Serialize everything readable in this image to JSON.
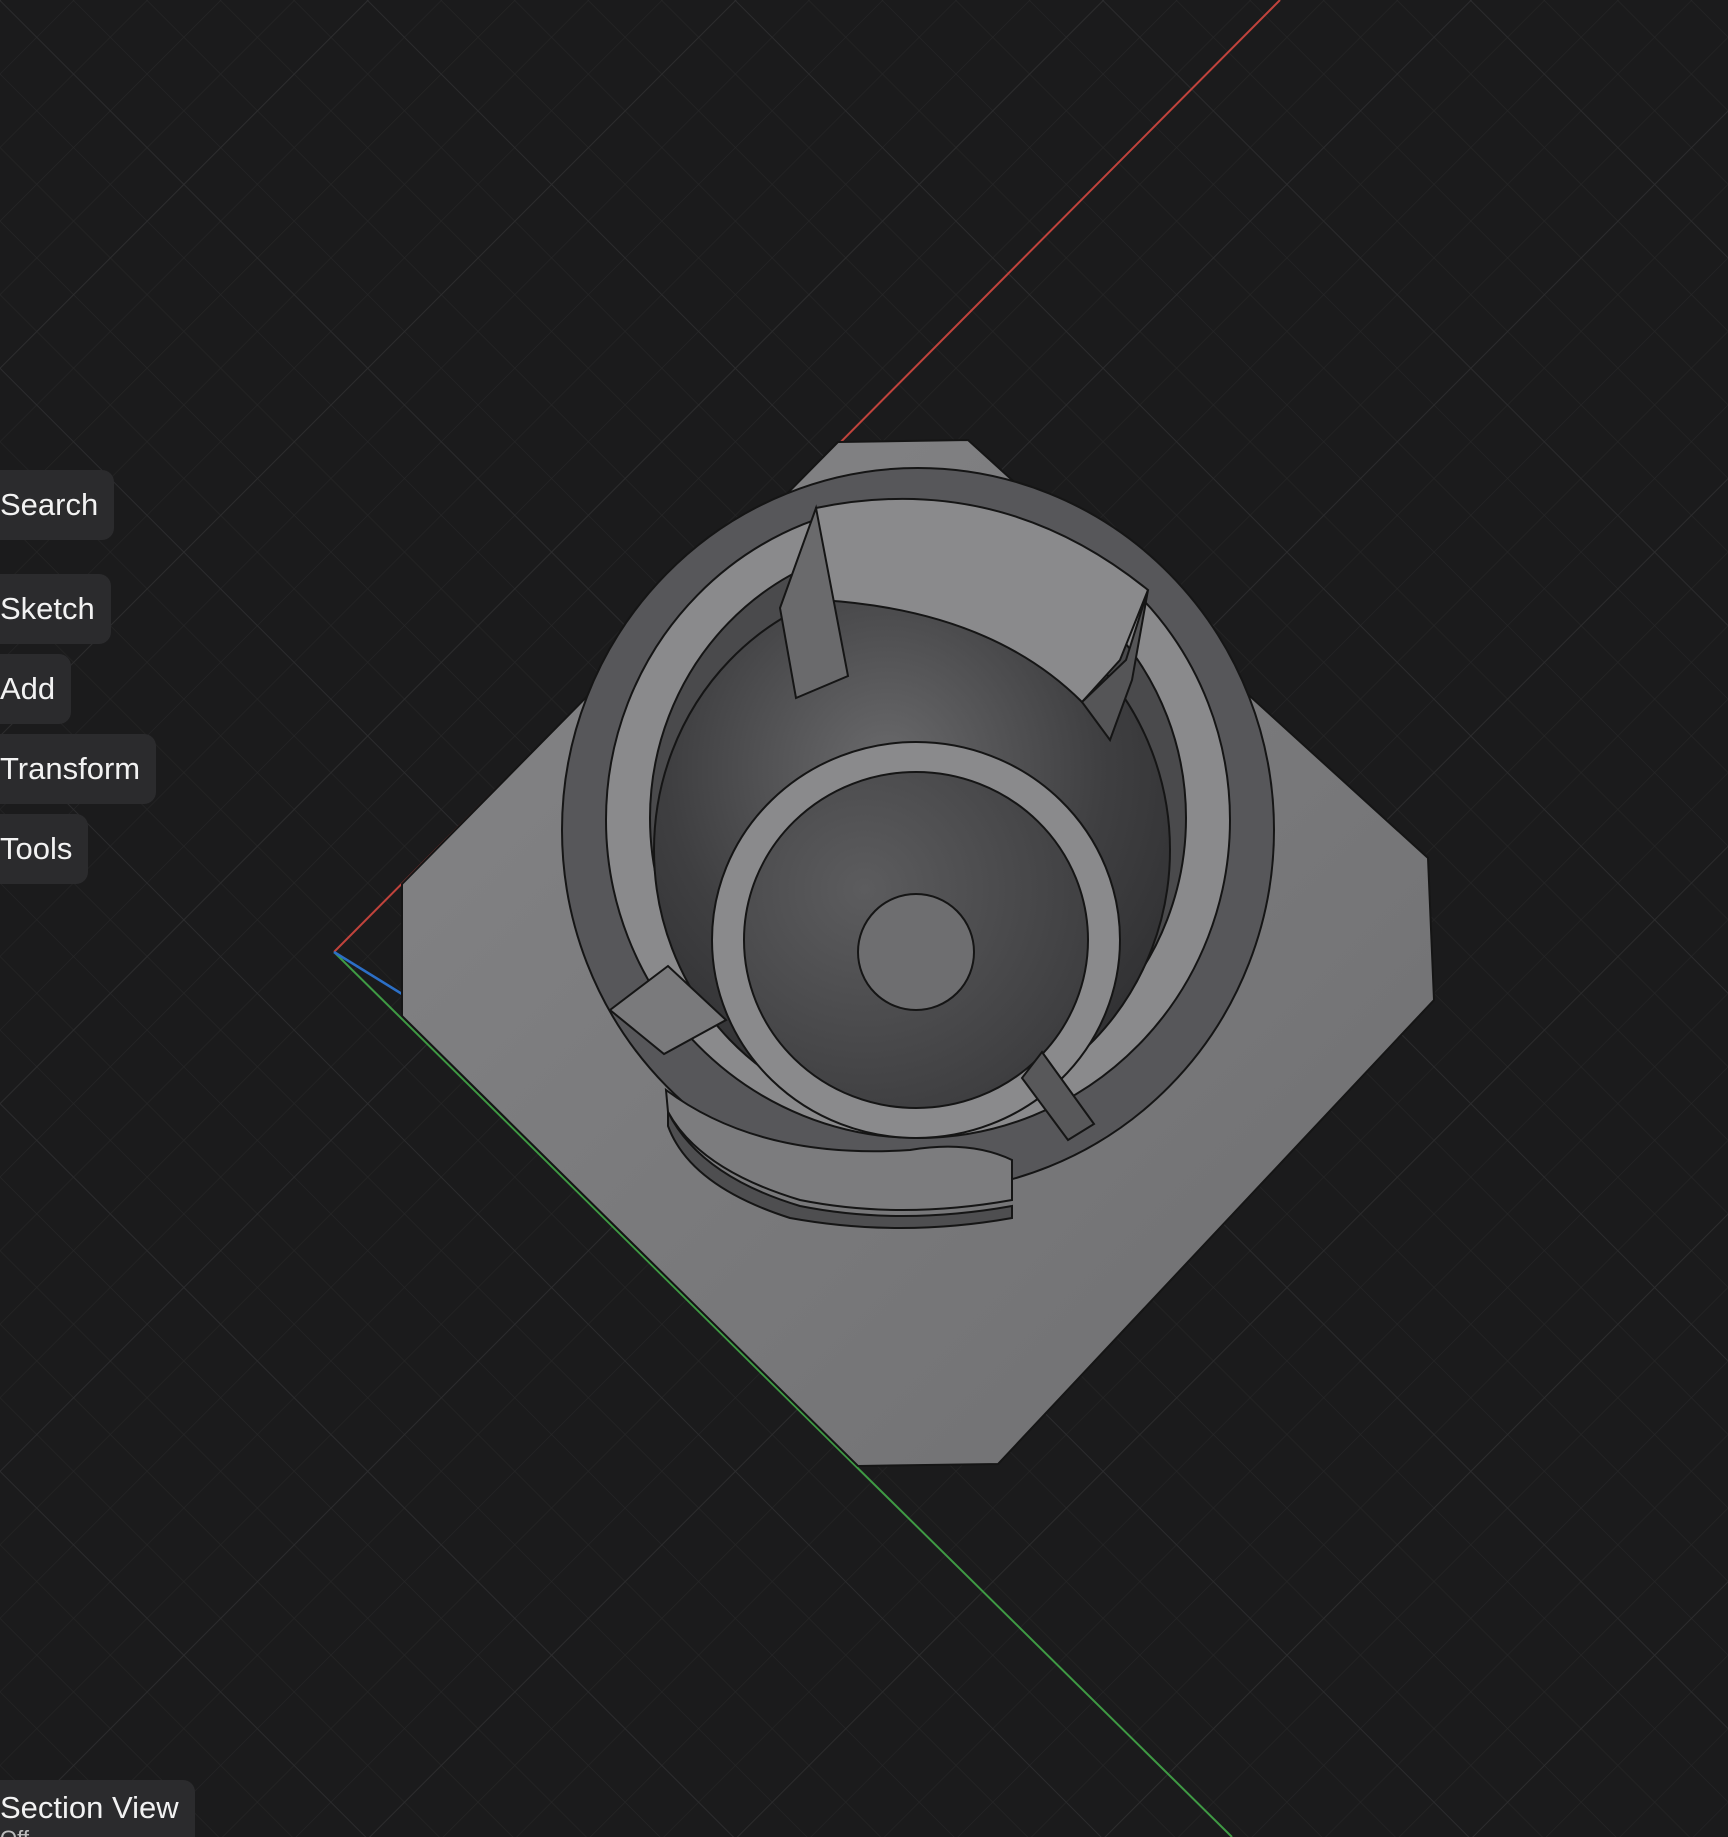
{
  "toolbar": {
    "search_label": "Search",
    "sketch_label": "Sketch",
    "add_label": "Add",
    "transform_label": "Transform",
    "tools_label": "Tools"
  },
  "section_view": {
    "label": "Section View",
    "state": "Off"
  },
  "viewport": {
    "background_color": "#1b1b1c",
    "grid_color": "#2a2a2b",
    "axis_colors": {
      "x": "#c0433c",
      "y": "#3f9a44",
      "z": "#2c6fc6"
    },
    "model_color": "#7a7a7c"
  }
}
